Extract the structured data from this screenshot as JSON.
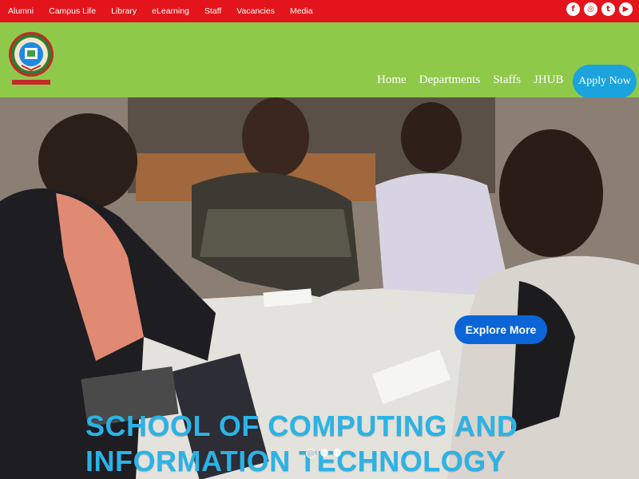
{
  "topbar": {
    "links": [
      "Alumni",
      "Campus Life",
      "Library",
      "eLearning",
      "Staff",
      "Vacancies",
      "Media"
    ],
    "social": [
      {
        "icon": "facebook-icon",
        "glyph": "f"
      },
      {
        "icon": "instagram-icon",
        "glyph": "◎"
      },
      {
        "icon": "twitter-icon",
        "glyph": "t"
      },
      {
        "icon": "youtube-icon",
        "glyph": "▶"
      }
    ]
  },
  "nav": {
    "links": [
      "Home",
      "Departments",
      "Staffs",
      "JHUB"
    ],
    "active": "Home",
    "apply_label": "Apply Now"
  },
  "hero": {
    "explore_label": "Explore More",
    "title_line1": "SCHOOL OF COMPUTING AND",
    "title_line2": "INFORMATION TECHNOLOGY"
  },
  "colors": {
    "topbar": "#e3141b",
    "navbar": "#8fc94a",
    "apply_button": "#1ba3dd",
    "explore_button": "#0b65d6",
    "hero_title": "#2bb3e6"
  }
}
